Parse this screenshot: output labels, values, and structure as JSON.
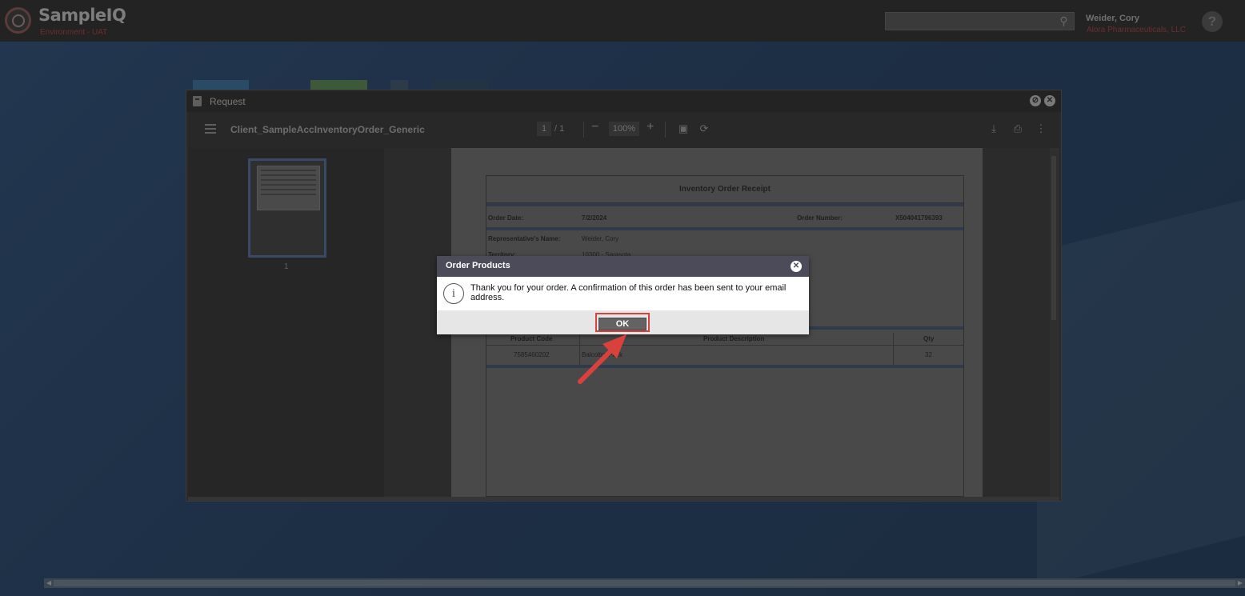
{
  "header": {
    "app_title": "SampleIQ",
    "environment": "Environment - UAT",
    "search_placeholder": "",
    "user_name": "Weider, Cory",
    "user_company": "Alora Pharmaceuticals, LLC",
    "help_symbol": "?"
  },
  "window": {
    "title": "Request",
    "pdf": {
      "document_name": "Client_SampleAccInventoryOrder_Generic",
      "current_page": "1",
      "page_total": "/  1",
      "zoom_out": "−",
      "zoom": "100%",
      "zoom_in": "+",
      "thumbnail_number": "1"
    },
    "receipt": {
      "title": "Inventory Order Receipt",
      "order_date_label": "Order Date:",
      "order_date": "7/2/2024",
      "order_number_label": "Order Number:",
      "order_number": "X504041796393",
      "rep_label": "Representative's Name:",
      "rep_value": "Weider, Cory",
      "territory_label": "Territory:",
      "territory_value": "10300 - Sarasota",
      "columns": [
        "Product Code",
        "Product Description",
        "Qty"
      ],
      "row": {
        "code": "7585460202",
        "description": "Balcoltra Pack",
        "qty": "32"
      }
    }
  },
  "dialog": {
    "title": "Order Products",
    "message": "Thank you for your order. A confirmation of this order has been sent to your email address.",
    "ok_label": "OK",
    "info_symbol": "i"
  },
  "colors": {
    "dialog_header": "#4b4b59",
    "highlight_red": "#d9413d",
    "brand_red": "#6b2e2e"
  },
  "icons": [
    "search-icon",
    "help-icon",
    "document-icon",
    "minimize-icon",
    "close-icon",
    "menu-icon",
    "fit-page-icon",
    "rotate-icon",
    "download-icon",
    "print-icon",
    "more-icon",
    "info-icon",
    "arrow-annotation"
  ]
}
